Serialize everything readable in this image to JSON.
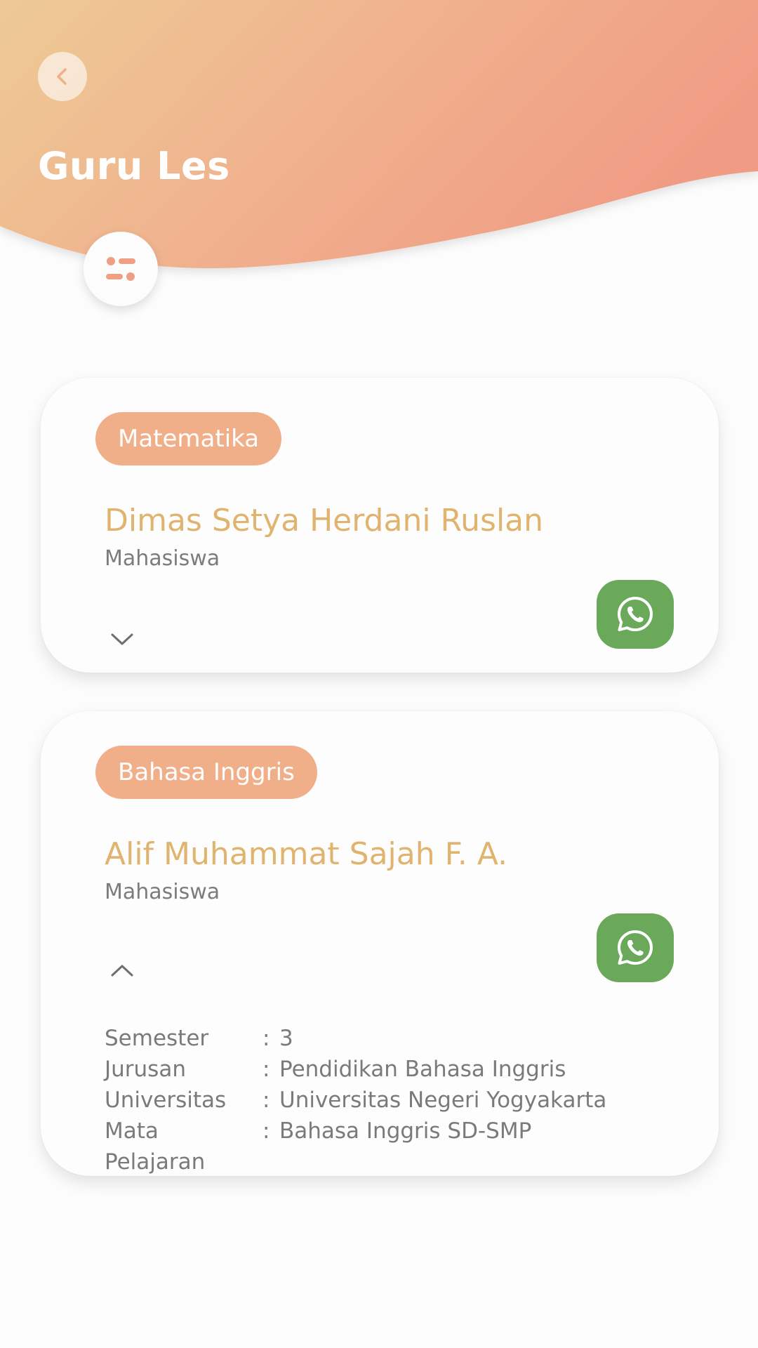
{
  "header": {
    "title": "Guru Les",
    "back_icon": "chevron-left-icon",
    "filter_icon": "filter-sliders-icon",
    "gradient": [
      "#edc994",
      "#f0a589",
      "#ef9a82"
    ]
  },
  "colors": {
    "badge": "#f0af88",
    "name": "#e0b36e",
    "whatsapp": "#6aa95a"
  },
  "tutors": [
    {
      "subject": "Matematika",
      "name": "Dimas Setya Herdani Ruslan",
      "role": "Mahasiswa",
      "expanded": false,
      "toggle_icon": "chevron-down-icon",
      "contact_icon": "whatsapp-icon"
    },
    {
      "subject": "Bahasa Inggris",
      "name": "Alif Muhammat Sajah F. A.",
      "role": "Mahasiswa",
      "expanded": true,
      "toggle_icon": "chevron-up-icon",
      "contact_icon": "whatsapp-icon",
      "details": [
        {
          "label": "Semester",
          "sep": ":",
          "value": "3"
        },
        {
          "label": "Jurusan",
          "sep": ":",
          "value": "Pendidikan Bahasa Inggris"
        },
        {
          "label": "Universitas",
          "sep": ":",
          "value": "Universitas Negeri Yogyakarta"
        },
        {
          "label": "Mata Pelajaran",
          "sep": ":",
          "value": "Bahasa Inggris SD-SMP"
        }
      ]
    }
  ]
}
